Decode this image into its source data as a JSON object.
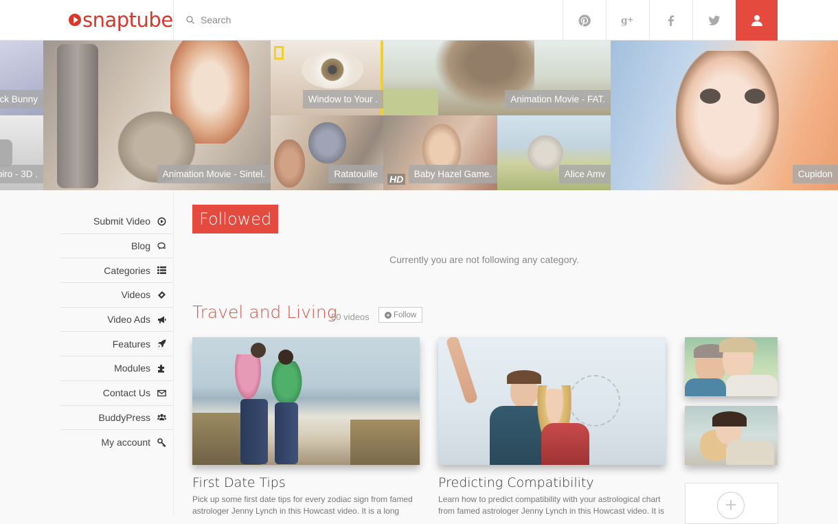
{
  "brand": {
    "name": "snaptube",
    "accent": "#e44a3d"
  },
  "search": {
    "placeholder": "Search"
  },
  "social": [
    {
      "name": "pinterest",
      "glyph": "P"
    },
    {
      "name": "google-plus",
      "glyph": "g+"
    },
    {
      "name": "facebook",
      "glyph": "f"
    },
    {
      "name": "twitter",
      "glyph": "t"
    }
  ],
  "featured": [
    {
      "caption": "ck Bunny"
    },
    {
      "caption": "piro - 3D ."
    },
    {
      "caption": "Animation Movie - Sintel."
    },
    {
      "caption": "Window to Your ."
    },
    {
      "caption": "Animation Movie - FAT."
    },
    {
      "caption": "Ratatouille"
    },
    {
      "caption": "Baby Hazel Game."
    },
    {
      "caption": "Alice Amv"
    },
    {
      "caption": "Cupidon"
    }
  ],
  "featured_hd": "HD",
  "sidebar": {
    "items": [
      {
        "label": "Submit Video",
        "icon": "play-circle-icon"
      },
      {
        "label": "Blog",
        "icon": "comments-icon"
      },
      {
        "label": "Categories",
        "icon": "list-icon"
      },
      {
        "label": "Videos",
        "icon": "ticket-icon"
      },
      {
        "label": "Video Ads",
        "icon": "bullhorn-icon"
      },
      {
        "label": "Features",
        "icon": "rocket-icon"
      },
      {
        "label": "Modules",
        "icon": "puzzle-icon"
      },
      {
        "label": "Contact Us",
        "icon": "envelope-icon"
      },
      {
        "label": "BuddyPress",
        "icon": "users-icon"
      },
      {
        "label": "My account",
        "icon": "key-icon"
      }
    ]
  },
  "main": {
    "followed_label": "Followed",
    "empty_message": "Currently you are not following any category.",
    "category": {
      "title": "Travel and Living",
      "count": "50 videos",
      "follow_label": "Follow"
    },
    "videos": [
      {
        "title": "First Date Tips",
        "description": "Pick up some first date tips for every zodiac sign from famed astrologer Jenny Lynch in this Howcast video. It is a long"
      },
      {
        "title": "Predicting Compatibility",
        "description": "Learn how to predict compatibility with your astrological chart from famed astrologer Jenny Lynch in this Howcast video. It is"
      }
    ],
    "add_more": "+"
  }
}
